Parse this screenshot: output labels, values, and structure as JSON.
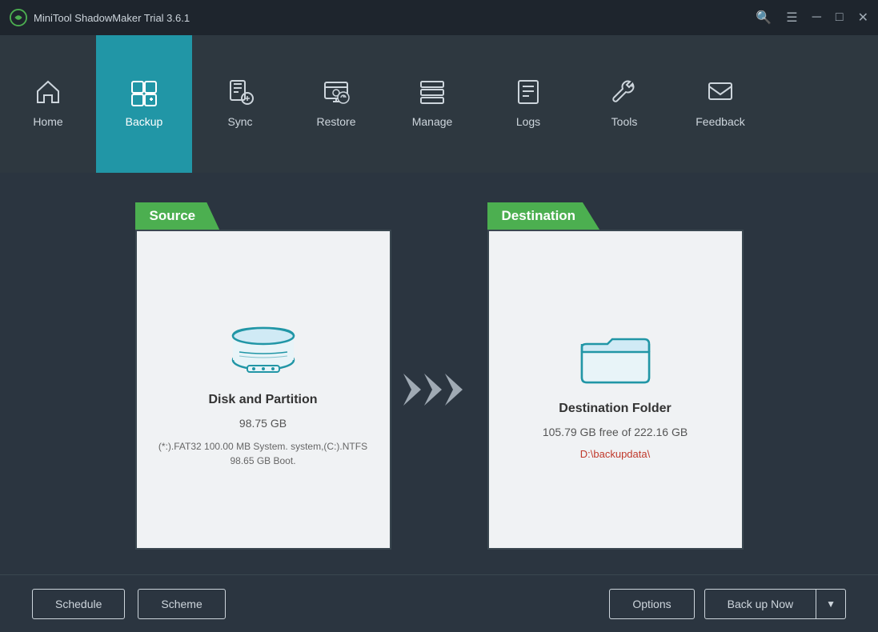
{
  "titlebar": {
    "title": "MiniTool ShadowMaker Trial 3.6.1"
  },
  "navbar": {
    "items": [
      {
        "id": "home",
        "label": "Home",
        "icon": "🏠",
        "active": false
      },
      {
        "id": "backup",
        "label": "Backup",
        "icon": "⊞",
        "active": true
      },
      {
        "id": "sync",
        "label": "Sync",
        "icon": "📄",
        "active": false
      },
      {
        "id": "restore",
        "label": "Restore",
        "icon": "🖥",
        "active": false
      },
      {
        "id": "manage",
        "label": "Manage",
        "icon": "📋",
        "active": false
      },
      {
        "id": "logs",
        "label": "Logs",
        "icon": "📰",
        "active": false
      },
      {
        "id": "tools",
        "label": "Tools",
        "icon": "🔧",
        "active": false
      },
      {
        "id": "feedback",
        "label": "Feedback",
        "icon": "✉",
        "active": false
      }
    ]
  },
  "source": {
    "label": "Source",
    "title": "Disk and Partition",
    "size": "98.75 GB",
    "detail": "(*:).FAT32 100.00 MB System. system,(C:).NTFS 98.65 GB Boot."
  },
  "destination": {
    "label": "Destination",
    "title": "Destination Folder",
    "free": "105.79 GB free of 222.16 GB",
    "path": "D:\\backupdata\\"
  },
  "bottombar": {
    "schedule_label": "Schedule",
    "scheme_label": "Scheme",
    "options_label": "Options",
    "backup_label": "Back up Now",
    "dropdown_icon": "▼"
  }
}
